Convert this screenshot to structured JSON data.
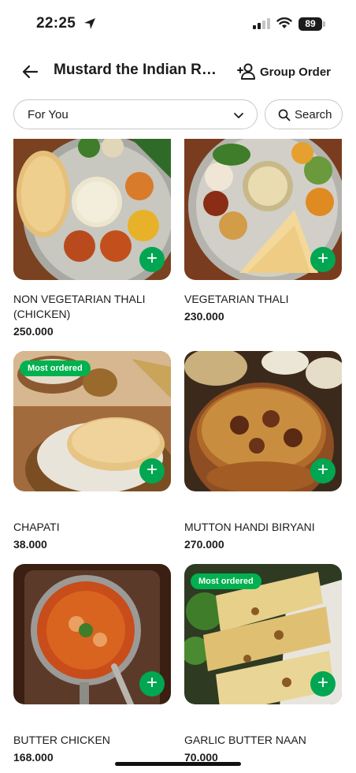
{
  "status_bar": {
    "time": "22:25",
    "battery": "89"
  },
  "header": {
    "title": "Mustard the Indian Re...",
    "group_order_label": "Group Order"
  },
  "filter": {
    "dropdown_label": "For You",
    "search_label": "Search"
  },
  "items": [
    {
      "name": "NON VEGETARIAN THALI (CHICKEN)",
      "price": "250.000",
      "badge": ""
    },
    {
      "name": "VEGETARIAN THALI",
      "price": "230.000",
      "badge": ""
    },
    {
      "name": "CHAPATI",
      "price": "38.000",
      "badge": "Most ordered"
    },
    {
      "name": "MUTTON HANDI BIRYANI",
      "price": "270.000",
      "badge": ""
    },
    {
      "name": "BUTTER CHICKEN",
      "price": "168.000",
      "badge": ""
    },
    {
      "name": "GARLIC BUTTER NAAN",
      "price": "70.000",
      "badge": "Most ordered"
    }
  ],
  "add_button_label": "+",
  "colors": {
    "accent_green": "#00a651",
    "badge_green": "#00b14f"
  }
}
